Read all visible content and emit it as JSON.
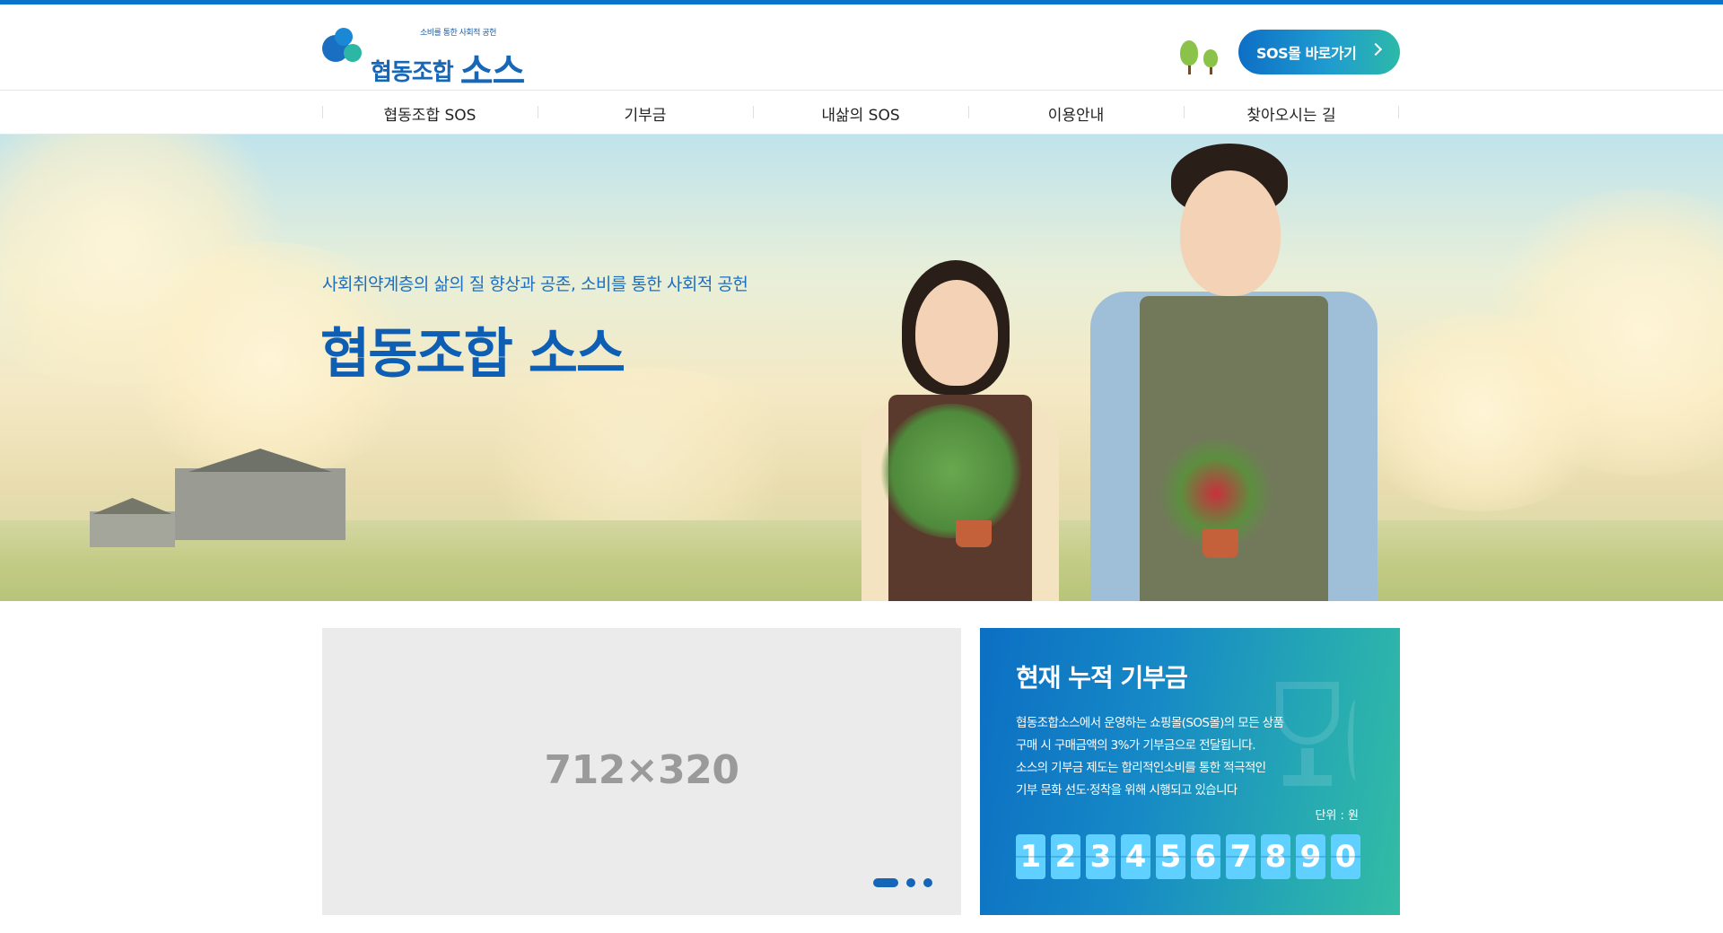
{
  "header": {
    "logo_tagline": "소비를 통한 사회적 공헌",
    "logo_name": "협동조합",
    "logo_name_big": "소스",
    "sos_button_label": "SOS몰 바로가기"
  },
  "nav": {
    "items": [
      {
        "label": "협동조합 SOS"
      },
      {
        "label": "기부금"
      },
      {
        "label": "내삶의 SOS"
      },
      {
        "label": "이용안내"
      },
      {
        "label": "찾아오시는 길"
      }
    ]
  },
  "hero": {
    "subtitle": "사회취약계층의 삶의 질 향상과 공존, 소비를 통한 사회적 공헌",
    "title": "협동조합 소스"
  },
  "slider": {
    "placeholder_label": "712×320",
    "dot_count": 3,
    "active_dot": 0
  },
  "donation": {
    "title": "현재 누적 기부금",
    "description_lines": [
      "협동조합소스에서 운영하는 쇼핑몰(SOS몰)의 모든 상품",
      "구매 시 구매금액의 3%가 기부금으로 전달됩니다.",
      "소스의 기부금 제도는 합리적인소비를 통한 적극적인",
      "기부 문화 선도·정착을 위해 시행되고 있습니다"
    ],
    "unit_label": "단위 : 원",
    "digits": [
      "1",
      "2",
      "3",
      "4",
      "5",
      "6",
      "7",
      "8",
      "9",
      "0"
    ]
  },
  "colors": {
    "brand_blue": "#0b73c9",
    "brand_teal": "#2cb9a8",
    "digit_bg": "#5fd0ff",
    "slider_bg": "#ebebeb"
  },
  "icons": {
    "tree_icon": "tree-icon",
    "button_chevron": "chevron-right-icon"
  }
}
